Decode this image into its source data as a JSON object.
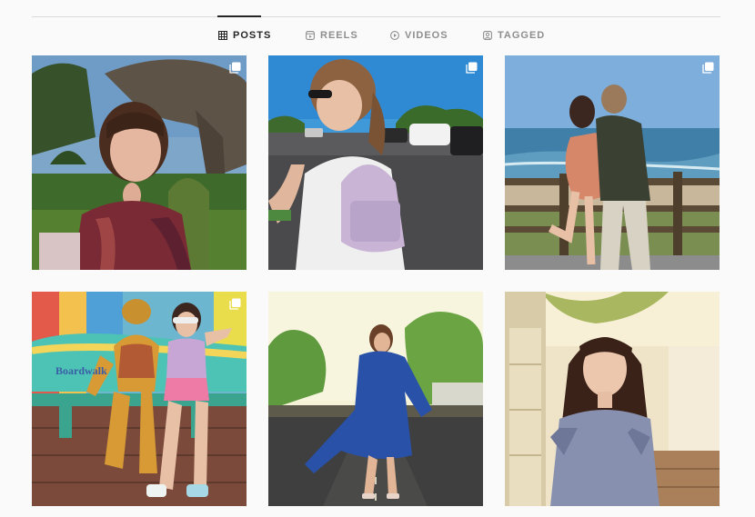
{
  "tabs": [
    {
      "id": "posts",
      "label": "POSTS",
      "icon": "grid-icon",
      "active": true
    },
    {
      "id": "reels",
      "label": "REELS",
      "icon": "reels-icon",
      "active": false
    },
    {
      "id": "videos",
      "label": "VIDEOS",
      "icon": "play-circle-icon",
      "active": false
    },
    {
      "id": "tagged",
      "label": "TAGGED",
      "icon": "tagged-user-icon",
      "active": false
    }
  ],
  "posts": [
    {
      "description": "woman with bangs in front of dinosaur statue",
      "multi": true
    },
    {
      "description": "woman with sunglasses and lilac backpack in parking lot",
      "multi": true
    },
    {
      "description": "couple kissing at seaside railing",
      "multi": true
    },
    {
      "description": "woman on surfboard bench with gecko statue",
      "multi": true,
      "sign_text": "Boardwalk"
    },
    {
      "description": "graduate in blue gown walking on road",
      "multi": false
    },
    {
      "description": "woman in floral dress on sunny porch",
      "multi": false
    }
  ],
  "colors": {
    "active_tab": "#262626",
    "inactive_tab": "#8e8e8e",
    "divider": "#dbdbdb"
  }
}
